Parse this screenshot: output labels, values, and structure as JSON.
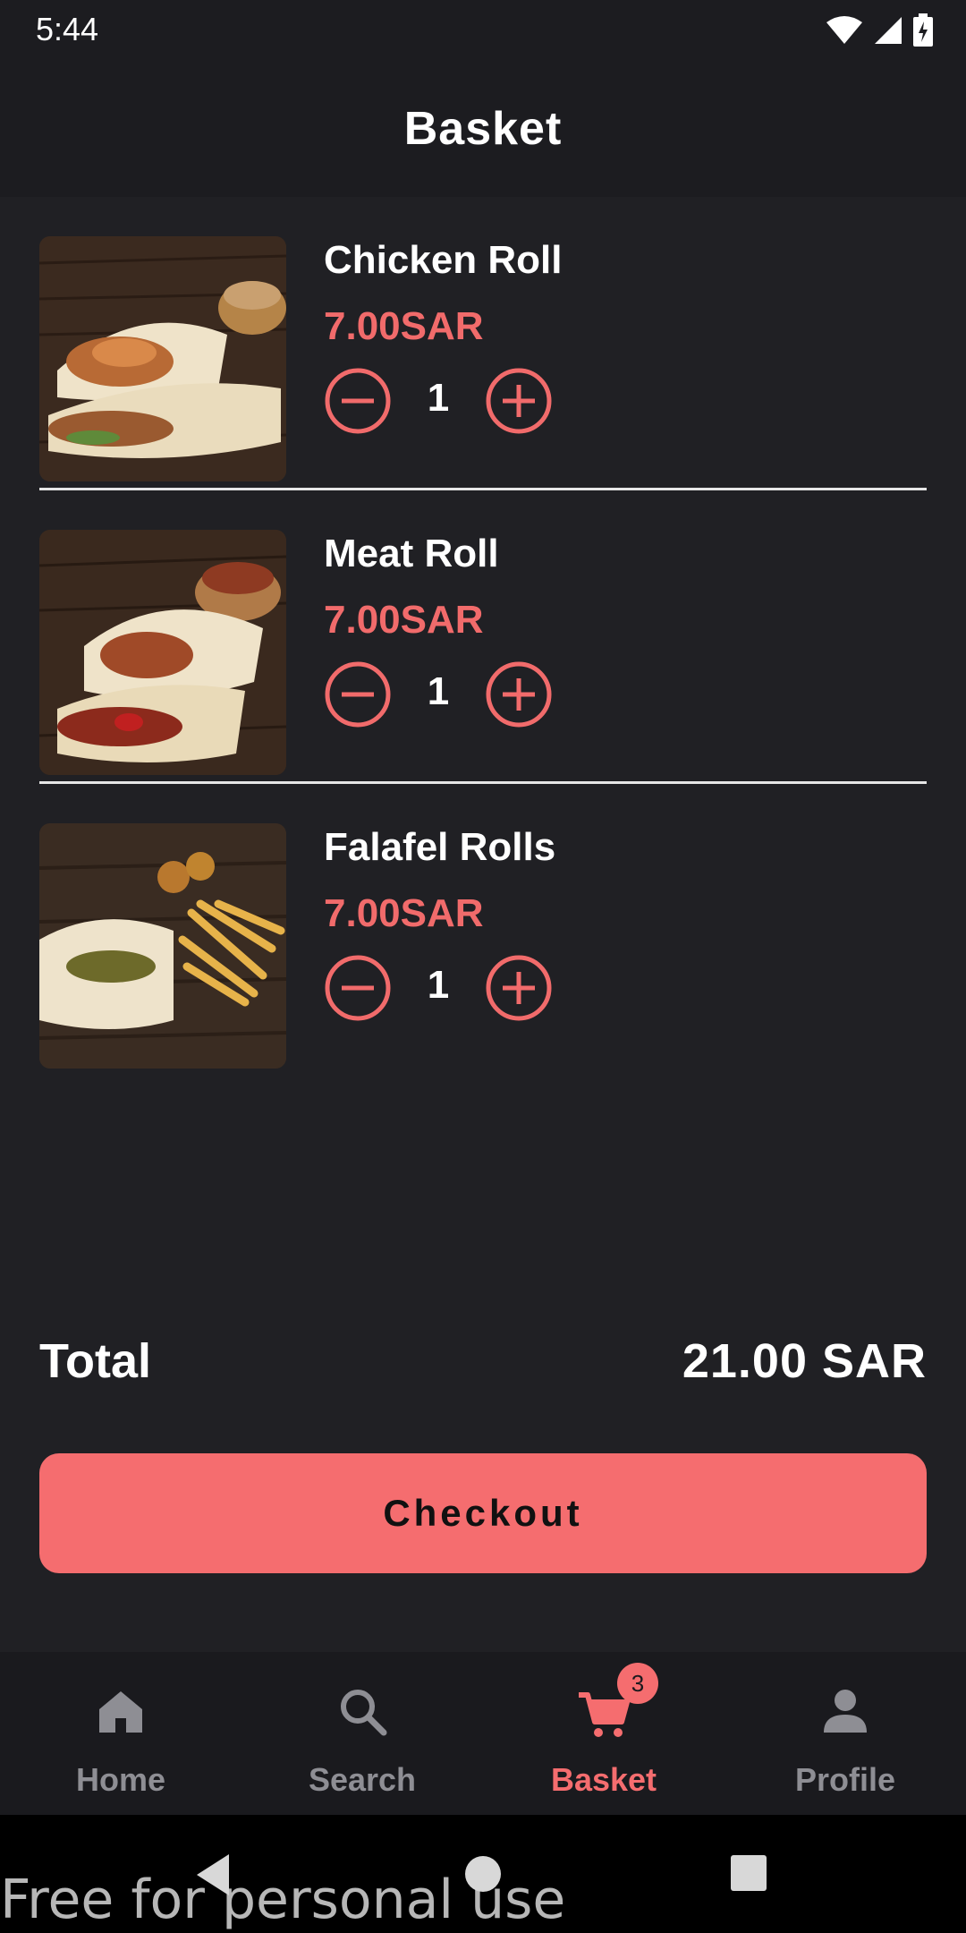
{
  "status_bar": {
    "time": "5:44"
  },
  "app_bar": {
    "title": "Basket"
  },
  "items": [
    {
      "name": "Chicken Roll",
      "price": "7.00SAR",
      "quantity": "1"
    },
    {
      "name": "Meat Roll",
      "price": "7.00SAR",
      "quantity": "1"
    },
    {
      "name": "Falafel Rolls",
      "price": "7.00SAR",
      "quantity": "1"
    }
  ],
  "total": {
    "label": "Total",
    "value": "21.00 SAR"
  },
  "checkout": {
    "label": "Checkout"
  },
  "bottom_nav": {
    "items": [
      {
        "label": "Home",
        "icon": "home-icon",
        "active": false
      },
      {
        "label": "Search",
        "icon": "search-icon",
        "active": false
      },
      {
        "label": "Basket",
        "icon": "cart-icon",
        "active": true,
        "badge": "3"
      },
      {
        "label": "Profile",
        "icon": "person-icon",
        "active": false
      }
    ]
  },
  "watermark": "Free for personal use",
  "colors": {
    "accent": "#f56d6f",
    "background": "#202024",
    "bar": "#1c1c20",
    "inactive": "#8e8e94"
  }
}
